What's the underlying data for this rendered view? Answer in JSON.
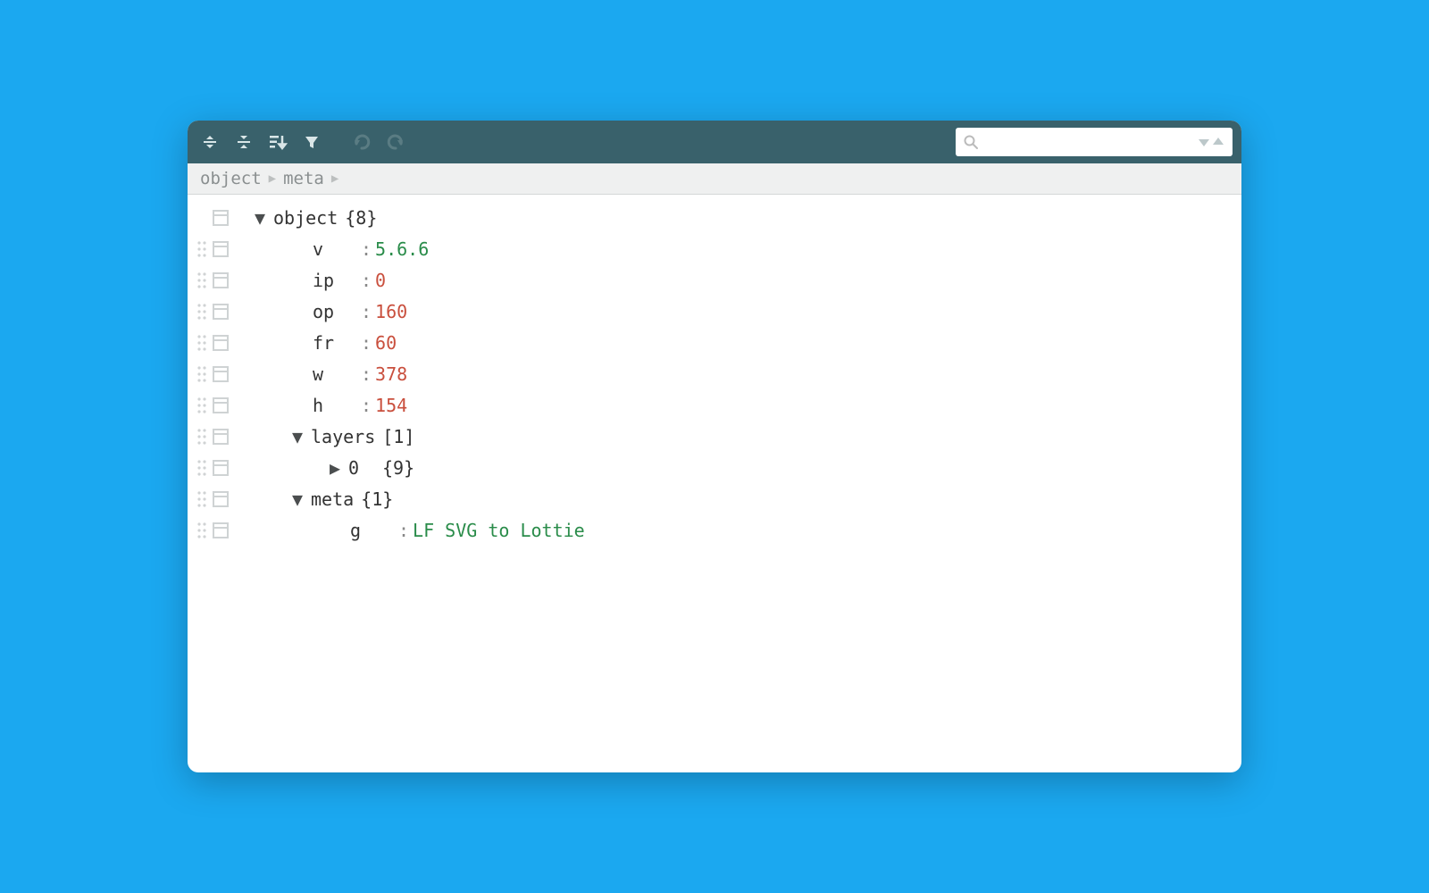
{
  "breadcrumb": {
    "seg1": "object",
    "seg2": "meta"
  },
  "tree": {
    "root": {
      "label": "object",
      "count": "{8}"
    },
    "v": {
      "key": "v",
      "value": "5.6.6"
    },
    "ip": {
      "key": "ip",
      "value": "0"
    },
    "op": {
      "key": "op",
      "value": "160"
    },
    "fr": {
      "key": "fr",
      "value": "60"
    },
    "w": {
      "key": "w",
      "value": "378"
    },
    "h": {
      "key": "h",
      "value": "154"
    },
    "layers": {
      "key": "layers",
      "count": "[1]"
    },
    "layers_0": {
      "key": "0",
      "count": "{9}"
    },
    "meta": {
      "key": "meta",
      "count": "{1}"
    },
    "meta_g": {
      "key": "g",
      "value": "LF SVG to Lottie"
    }
  },
  "search": {
    "placeholder": ""
  }
}
